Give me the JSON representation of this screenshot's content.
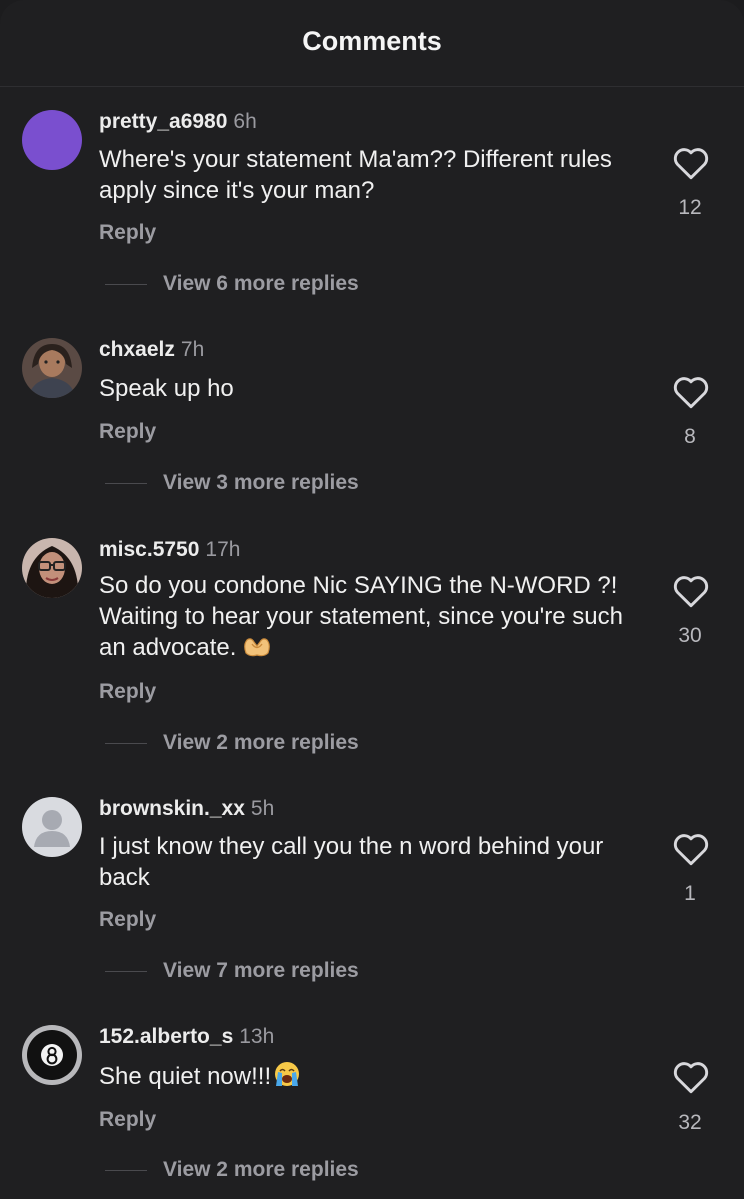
{
  "header": {
    "title": "Comments"
  },
  "comments": [
    {
      "username": "pretty_a6980",
      "time": "6h",
      "text": "Where's your statement Ma'am?? Different rules apply since it's your man?",
      "reply": "Reply",
      "more_replies": "View 6 more replies",
      "likes": "12",
      "avatar_color": "#7a4fcf"
    },
    {
      "username": "chxaelz",
      "time": "7h",
      "text": "Speak up ho",
      "reply": "Reply",
      "more_replies": "View 3 more replies",
      "likes": "8"
    },
    {
      "username": "misc.5750",
      "time": "17h",
      "text": "So do you condone Nic SAYING the N-WORD ?! Waiting to hear your statement, since you're such an advocate.",
      "reply": "Reply",
      "more_replies": "View 2 more replies",
      "likes": "30"
    },
    {
      "username": "brownskin._xx",
      "time": "5h",
      "text": "I just know they call you the n word behind your back",
      "reply": "Reply",
      "more_replies": "View 7 more replies",
      "likes": "1"
    },
    {
      "username": "152.alberto_s",
      "time": "13h",
      "text": "She quiet now!!!",
      "reply": "Reply",
      "more_replies": "View 2 more replies",
      "likes": "32"
    }
  ]
}
